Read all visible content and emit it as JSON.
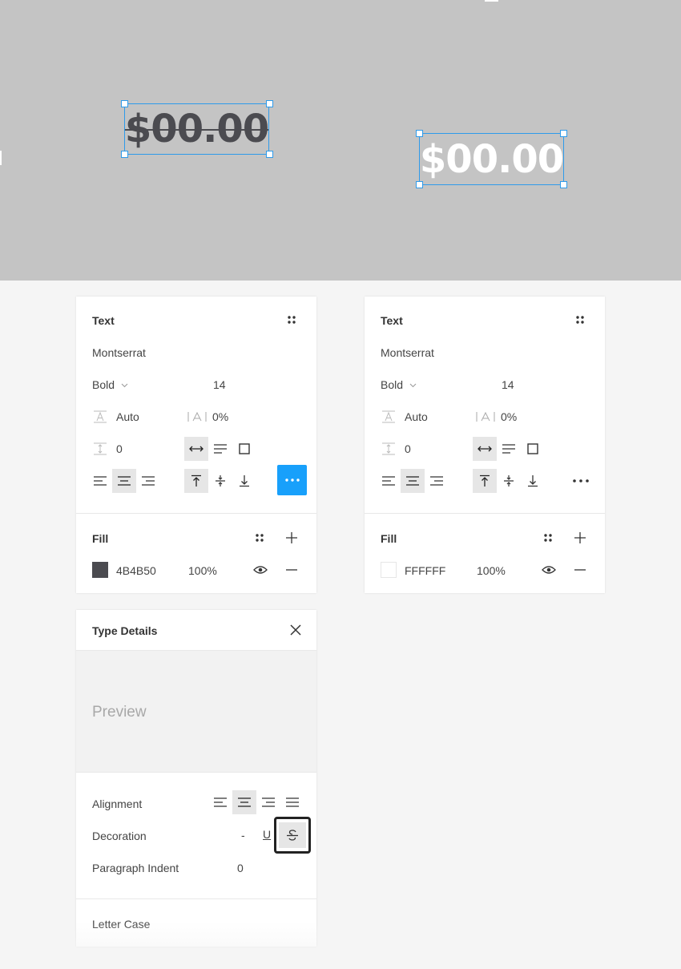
{
  "canvas": {
    "left_text": {
      "value": "$00.00",
      "color": "#4B4B50",
      "decoration": "strikethrough"
    },
    "right_text": {
      "value": "$00.00",
      "color": "#FFFFFF"
    },
    "selection_color": "#2F9BEA",
    "background": "#C4C4C4"
  },
  "panel_left": {
    "section_title": "Text",
    "font_family": "Montserrat",
    "font_weight": "Bold",
    "font_size": "14",
    "line_height": "Auto",
    "letter_spacing": "0%",
    "paragraph_spacing": "0",
    "fill_title": "Fill",
    "fill_hex": "4B4B50",
    "fill_opacity": "100%",
    "fill_color": "#4B4B50",
    "more_button_active": true
  },
  "panel_right": {
    "section_title": "Text",
    "font_family": "Montserrat",
    "font_weight": "Bold",
    "font_size": "14",
    "line_height": "Auto",
    "letter_spacing": "0%",
    "paragraph_spacing": "0",
    "fill_title": "Fill",
    "fill_hex": "FFFFFF",
    "fill_opacity": "100%",
    "fill_color": "#FFFFFF",
    "more_button_active": false
  },
  "type_details": {
    "title": "Type Details",
    "preview_label": "Preview",
    "alignment_label": "Alignment",
    "decoration_label": "Decoration",
    "decoration_none": "-",
    "decoration_underline": "U",
    "decoration_selected": "strikethrough",
    "paragraph_indent_label": "Paragraph Indent",
    "paragraph_indent_value": "0",
    "letter_case_label": "Letter Case"
  },
  "accent_color": "#18A0FB"
}
